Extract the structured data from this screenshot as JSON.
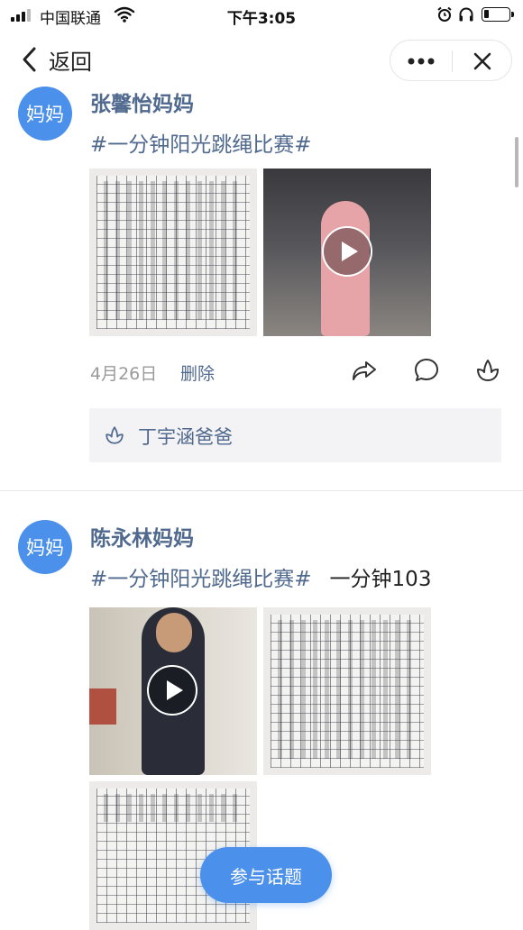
{
  "status_bar": {
    "carrier": "中国联通",
    "time": "下午3:05",
    "battery_level": 0.2
  },
  "nav": {
    "back_label": "返回",
    "more_icon": "more-dots-icon",
    "close_icon": "close-icon"
  },
  "posts": [
    {
      "avatar_text": "妈妈",
      "author": "张馨怡妈妈",
      "topic": "#一分钟阳光跳绳比赛#",
      "text": "",
      "media": [
        {
          "kind": "photo",
          "icon": "handwritten-paper"
        },
        {
          "kind": "video",
          "icon": "play-icon"
        }
      ],
      "date": "4月26日",
      "delete_label": "删除",
      "likes": [
        "丁宇涵爸爸"
      ]
    },
    {
      "avatar_text": "妈妈",
      "author": "陈永林妈妈",
      "topic": "#一分钟阳光跳绳比赛#",
      "text": "一分钟103",
      "media": [
        {
          "kind": "video",
          "icon": "play-icon"
        },
        {
          "kind": "photo",
          "icon": "handwritten-paper"
        },
        {
          "kind": "photo",
          "icon": "handwritten-paper"
        }
      ]
    }
  ],
  "join_button_label": "参与话题",
  "colors": {
    "accent": "#4b90ea",
    "link": "#50698e",
    "muted": "#9a9a9a"
  }
}
